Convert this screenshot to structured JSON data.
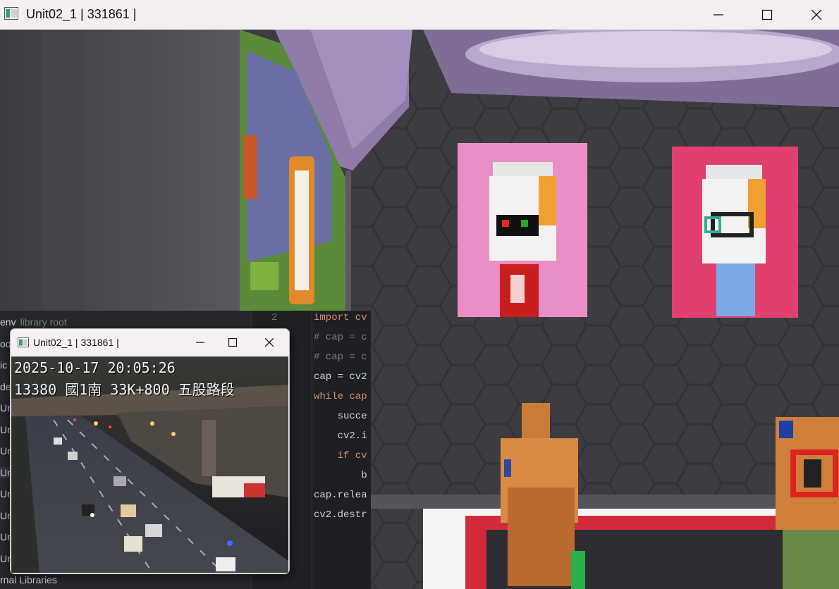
{
  "window": {
    "title": "Unit02_1 | 331861 |",
    "icon": "app-window-icon",
    "controls": [
      "minimize-icon",
      "maximize-icon",
      "close-icon"
    ]
  },
  "ide": {
    "project_items": [
      {
        "text": "env",
        "suffix": "library root"
      },
      {
        "text": "oo"
      },
      {
        "text": "ic"
      },
      {
        "text": "de"
      },
      {
        "text": "Ur"
      },
      {
        "text": "Ur"
      },
      {
        "text": "Ur"
      },
      {
        "text": "Ur"
      },
      {
        "text": "Ur"
      },
      {
        "text": "Ur"
      },
      {
        "text": "Ur"
      },
      {
        "text": "Ur"
      },
      {
        "text": "rnal Libraries"
      }
    ],
    "line_number": "2",
    "code_lines": [
      {
        "text": "import cv",
        "cls": "kw"
      },
      {
        "text": "# cap = c",
        "cls": "cm"
      },
      {
        "text": "# cap = c",
        "cls": "cm"
      },
      {
        "text": "cap = cv2",
        "cls": ""
      },
      {
        "text": "while cap",
        "cls": "kw"
      },
      {
        "text": "    succe",
        "cls": ""
      },
      {
        "text": "    cv2.i",
        "cls": ""
      },
      {
        "text": "    if cv",
        "cls": "kw"
      },
      {
        "text": "        b",
        "cls": ""
      },
      {
        "text": "cap.relea",
        "cls": ""
      },
      {
        "text": "cv2.destr",
        "cls": ""
      }
    ]
  },
  "popup": {
    "title": "Unit02_1 | 331861 |",
    "osd_line1": "2025-10-17  20:05:26",
    "osd_line2": "13380  國1南  33K+800  五股路段"
  },
  "colors": {
    "titlebar": "#f3eef1",
    "poster_left": "#e98fc6",
    "poster_right": "#e1406f",
    "wall": "#3b3a3e"
  }
}
